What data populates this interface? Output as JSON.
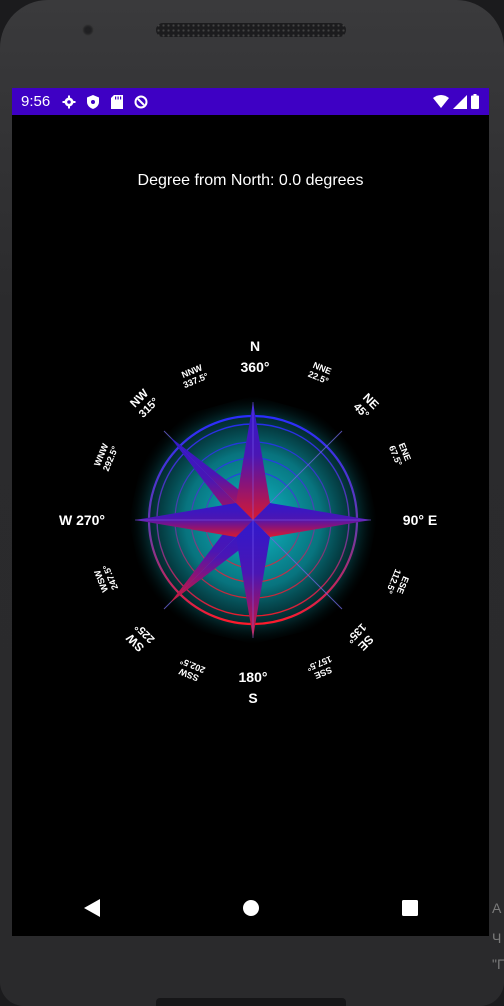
{
  "status_bar": {
    "time": "9:56",
    "icons_left": [
      "gear-icon",
      "shield-icon",
      "sd-card-icon",
      "sync-icon"
    ],
    "icons_right": [
      "wifi-icon",
      "signal-icon",
      "battery-icon"
    ],
    "background": "#3e00c4"
  },
  "compass": {
    "heading_text": "Degree from North: 0.0 degrees",
    "directions": {
      "n": "N",
      "n_deg": "360°",
      "nne": "NNE",
      "nne_deg": "22.5°",
      "ne": "NE",
      "ne_deg": "45°",
      "ene": "ENE",
      "ene_deg": "67.5°",
      "e": "90° E",
      "ese": "ESE",
      "ese_deg": "112.5°",
      "se": "SE",
      "se_deg": "135°",
      "sse": "SSE",
      "sse_deg": "157.5°",
      "s": "S",
      "s_deg": "180°",
      "ssw": "SSW",
      "ssw_deg": "202.5°",
      "sw": "SW",
      "sw_deg": "225°",
      "wsw": "WSW",
      "wsw_deg": "247.5°",
      "w": "W 270°",
      "wnw": "WNW",
      "wnw_deg": "292.5°",
      "nw": "NW",
      "nw_deg": "315°",
      "nnw": "NNW",
      "nnw_deg": "337.5°"
    },
    "colors": {
      "star_top": "#3a19c9",
      "star_bottom": "#d01a3c",
      "glow": "#0a8a96"
    }
  },
  "nav_bar": {
    "icons": [
      "back-icon",
      "home-icon",
      "recents-icon"
    ]
  },
  "side_text": {
    "line1": "A",
    "line2": "Ч",
    "line3": "\"Г"
  }
}
